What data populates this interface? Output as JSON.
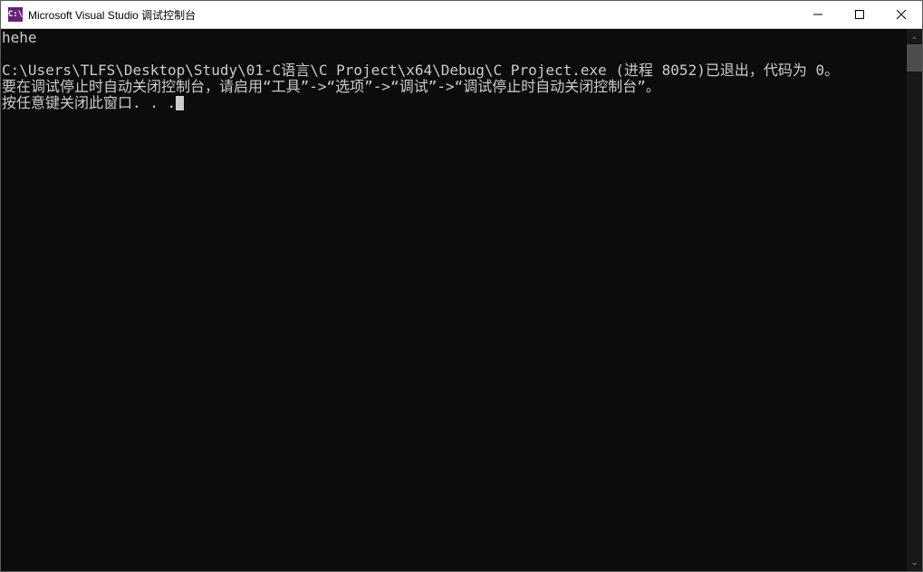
{
  "window": {
    "title": "Microsoft Visual Studio 调试控制台",
    "icon_label": "C:\\"
  },
  "console": {
    "lines": {
      "l1": "hehe",
      "l2": "",
      "l3": "C:\\Users\\TLFS\\Desktop\\Study\\01-C语言\\C Project\\x64\\Debug\\C Project.exe (进程 8052)已退出，代码为 0。",
      "l4": "要在调试停止时自动关闭控制台，请启用“工具”->“选项”->“调试”->“调试停止时自动关闭控制台”。",
      "l5": "按任意键关闭此窗口. . ."
    }
  },
  "colors": {
    "console_bg": "#0c0c0c",
    "console_fg": "#cccccc",
    "titlebar_bg": "#ffffff",
    "vs_purple": "#68217a"
  }
}
